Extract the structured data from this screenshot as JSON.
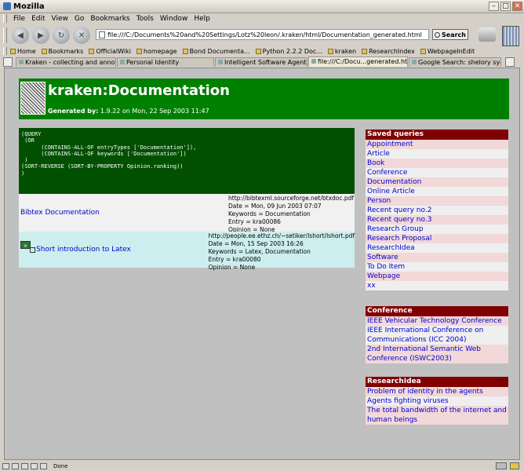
{
  "window": {
    "title": "Mozilla"
  },
  "menu": [
    "File",
    "Edit",
    "View",
    "Go",
    "Bookmarks",
    "Tools",
    "Window",
    "Help"
  ],
  "nav": {
    "url": "file:///C:/Documents%20and%20Settings/Lotz%20leon/.kraken/html/Documentation_generated.html",
    "search_label": "Search"
  },
  "bookmarks": [
    "Home",
    "Bookmarks",
    "OfficialWiki",
    "homepage",
    "Bond Documenta...",
    "Python 2.2.2 Doc...",
    "kraken",
    "ResearchIndex",
    "WebpageInEdit"
  ],
  "tabs": [
    "Kraken - collecting and annota...",
    "Personal Identity",
    "Intelligent Software Agents",
    "file:///C:/Docu...generated.html",
    "Google Search: shelory sycard"
  ],
  "header": {
    "title": "kraken:Documentation",
    "generated_label": "Generated by:",
    "generated_value": " 1.9.22 on Mon, 22 Sep 2003 11:47"
  },
  "query": "(QUERY\n (OR\n      (CONTAINS-ALL-OF entryTypes ['Documentation']),\n      (CONTAINS-ALL-OF keywords ['Documentation'])\n )\n(SORT-REVERSE (SORT-BY-PROPERTY Opinion.ranking))\n)",
  "results": [
    {
      "title": "Bibtex Documentation",
      "url": "http://bibtexml.sourceforge.net/btxdoc.pdf",
      "date": "Date = Mon, 09 Jun 2003 07:07",
      "keywords": "Keywords = Documentation",
      "entry": "Entry = kra00086",
      "opinion": "Opinion = None"
    },
    {
      "title": "Short introduction to Latex",
      "url": "http://people.ee.ethz.ch/~setiker/lshort/lshort.pdf",
      "date": "Date = Mon, 15 Sep 2003 16:26",
      "keywords": "Keywords = Latex, Documentation",
      "entry": "Entry = kra00080",
      "opinion": "Opinion = None"
    }
  ],
  "saved_queries": {
    "title": "Saved queries",
    "items": [
      "Appointment",
      "Article",
      "Book",
      "Conference",
      "Documentation",
      "Online Article",
      "Person",
      "Recent query no.2",
      "Recent query no.3",
      "Research Group",
      "Research Proposal",
      "ResearchIdea",
      "Software",
      "To Do Item",
      "Webpage",
      "xx"
    ]
  },
  "conference": {
    "title": "Conference",
    "items": [
      "IEEE Vehicular Technology Conference",
      "IEEE International Conference on Communications (ICC 2004)",
      "2nd International Semantic Web Conference (ISWC2003)"
    ]
  },
  "researchidea": {
    "title": "ResearchIdea",
    "items": [
      "Problem of identity in the agents",
      "Agents fighting viruses",
      "The total bandwidth of the internet and human beings"
    ]
  },
  "status": {
    "text": "Done"
  }
}
